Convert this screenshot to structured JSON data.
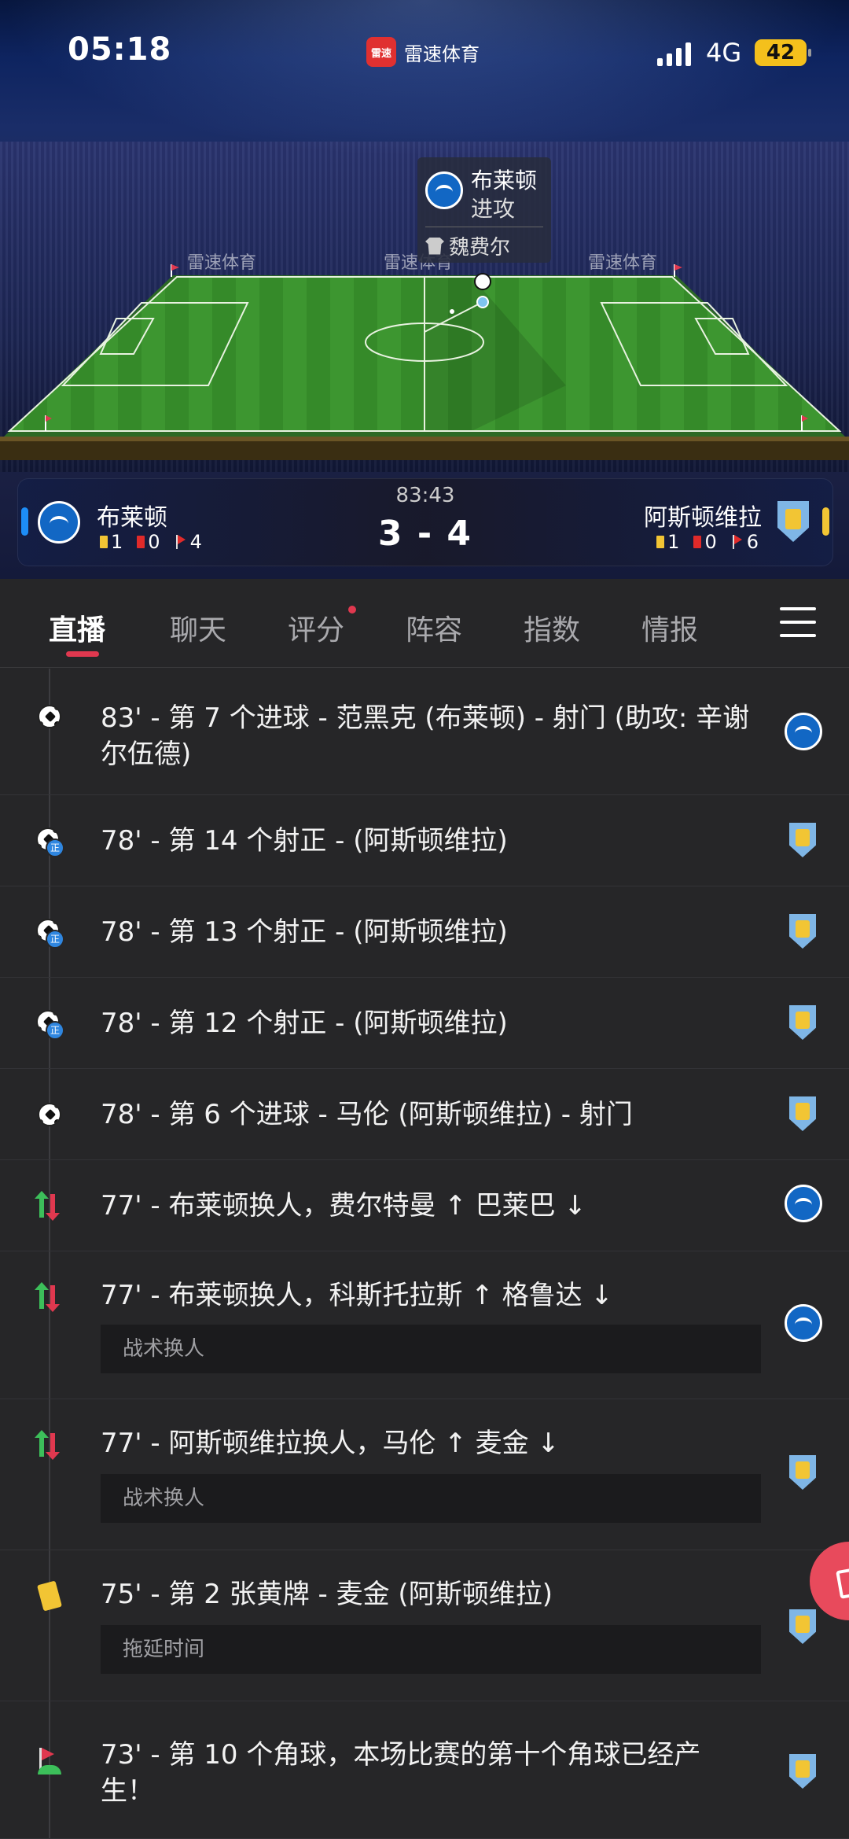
{
  "status_bar": {
    "time": "05:18",
    "app_name": "雷速体育",
    "app_logo_text": "雷速",
    "network": "4G",
    "battery": "42"
  },
  "popup": {
    "team": "布莱顿",
    "action": "进攻",
    "player": "魏费尔"
  },
  "boards": {
    "sponsor": "雷速体育"
  },
  "scoreboard": {
    "clock": "83:43",
    "score": "3 - 4",
    "home": {
      "name": "布莱顿",
      "yellow": "1",
      "red": "0",
      "corners": "4"
    },
    "away": {
      "name": "阿斯顿维拉",
      "yellow": "1",
      "red": "0",
      "corners": "6"
    }
  },
  "tabs": [
    "直播",
    "聊天",
    "评分",
    "阵容",
    "指数",
    "情报"
  ],
  "events": [
    {
      "icon": "goal",
      "text": "83' - 第 7 个进球 - 范黑克 (布莱顿) - 射门 (助攻: 辛谢尔伍德)",
      "team": "home"
    },
    {
      "icon": "shot-on-target",
      "text": "78' - 第 14 个射正 - (阿斯顿维拉)",
      "team": "away"
    },
    {
      "icon": "shot-on-target",
      "text": "78' - 第 13 个射正 - (阿斯顿维拉)",
      "team": "away"
    },
    {
      "icon": "shot-on-target",
      "text": "78' - 第 12 个射正 - (阿斯顿维拉)",
      "team": "away"
    },
    {
      "icon": "goal",
      "text": "78' - 第 6 个进球 - 马伦 (阿斯顿维拉) - 射门",
      "team": "away"
    },
    {
      "icon": "substitution",
      "text": "77' - 布莱顿换人，费尔特曼 ↑ 巴莱巴 ↓",
      "team": "home"
    },
    {
      "icon": "substitution",
      "text": "77' - 布莱顿换人，科斯托拉斯 ↑ 格鲁达 ↓",
      "note": "战术换人",
      "team": "home"
    },
    {
      "icon": "substitution",
      "text": "77' - 阿斯顿维拉换人，马伦 ↑ 麦金 ↓",
      "note": "战术换人",
      "team": "away"
    },
    {
      "icon": "yellow-card",
      "text": "75' - 第 2 张黄牌 - 麦金 (阿斯顿维拉)",
      "note": "拖延时间",
      "team": "away"
    },
    {
      "icon": "corner",
      "text": "73' - 第 10 个角球，本场比赛的第十个角球已经产生！",
      "team": "away"
    }
  ],
  "badge_text": "正",
  "colors": {
    "accent": "#e0384f",
    "home": "#1267c4",
    "away_blue": "#7fb6e6",
    "yellow": "#f2c534",
    "pitch": "#3a8f2e"
  }
}
